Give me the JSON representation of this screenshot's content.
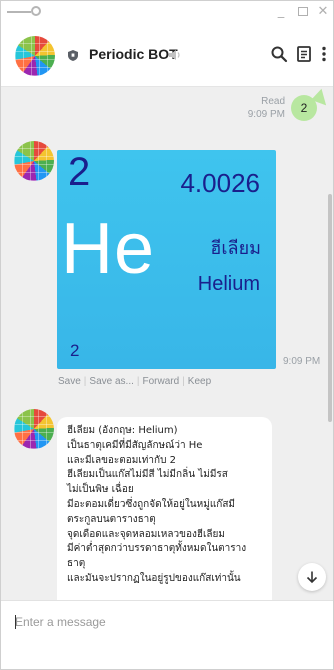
{
  "header": {
    "bot_name": "Periodic BOT"
  },
  "outgoing": {
    "status": "Read",
    "time": "9:09 PM",
    "text": "2"
  },
  "element_card": {
    "number_top": "2",
    "mass": "4.0026",
    "symbol": "He",
    "name_thai": "ฮีเลียม",
    "name_en": "Helium",
    "number_bottom": "2",
    "time": "9:09 PM"
  },
  "actions": {
    "save": "Save",
    "save_as": "Save as...",
    "forward": "Forward",
    "keep": "Keep"
  },
  "message_text": "ฮีเลียม (อังกฤษ: Helium)\nเป็นธาตุเคมีที่มีสัญลักษณ์ว่า He\nและมีเลขอะตอมเท่ากับ 2\nฮีเลียมเป็นแก๊สไม่มีสี ไม่มีกลิ่น ไม่มีรส\nไม่เป็นพิษ เฉื่อย\nมีอะตอมเดี่ยวซึ่งถูกจัดให้อยู่ในหมู่แก๊สมี\nตระกูลบนตารางธาตุ\nจุดเดือดและจุดหลอมเหลวของฮีเลียม\nมีค่าต่ำสุดกว่าบรรดาธาตุทั้งหมดในตาราง\nธาตุ\nและมันจะปรากฏในอยู่รูปของแก๊สเท่านั้น",
  "input": {
    "placeholder": "Enter a message"
  },
  "colors": {
    "outgoing_bubble": "#b8e7a0",
    "element_card_bg": "#3fc4ee",
    "element_text": "#1a1f8c"
  }
}
